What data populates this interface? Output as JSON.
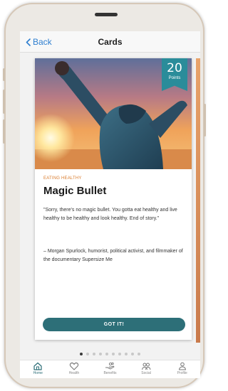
{
  "navbar": {
    "back_label": "Back",
    "title": "Cards"
  },
  "card": {
    "points_value": "20",
    "points_label": "Points",
    "category": "EATING HEALTHY",
    "title": "Magic Bullet",
    "quote": "\"Sorry, there's no magic bullet. You gotta eat healthy and live healthy to be healthy and look healthy. End of story.\"",
    "attribution": "– Morgan Spurlock, humorist, political activist, and filmmaker of the documentary Supersize Me",
    "button_label": "GOT IT!"
  },
  "pagination": {
    "count": 10,
    "active_index": 0
  },
  "tabbar": {
    "items": [
      {
        "label": "Home",
        "icon": "home-icon",
        "active": true
      },
      {
        "label": "Health",
        "icon": "heart-icon",
        "active": false
      },
      {
        "label": "Benefits",
        "icon": "hand-coins-icon",
        "active": false
      },
      {
        "label": "Social",
        "icon": "people-icon",
        "active": false
      },
      {
        "label": "Profile",
        "icon": "person-icon",
        "active": false
      }
    ]
  },
  "colors": {
    "accent": "#2d6f78",
    "badge": "#2a8c9a",
    "link": "#2f7fd0",
    "category": "#d97a2a"
  }
}
